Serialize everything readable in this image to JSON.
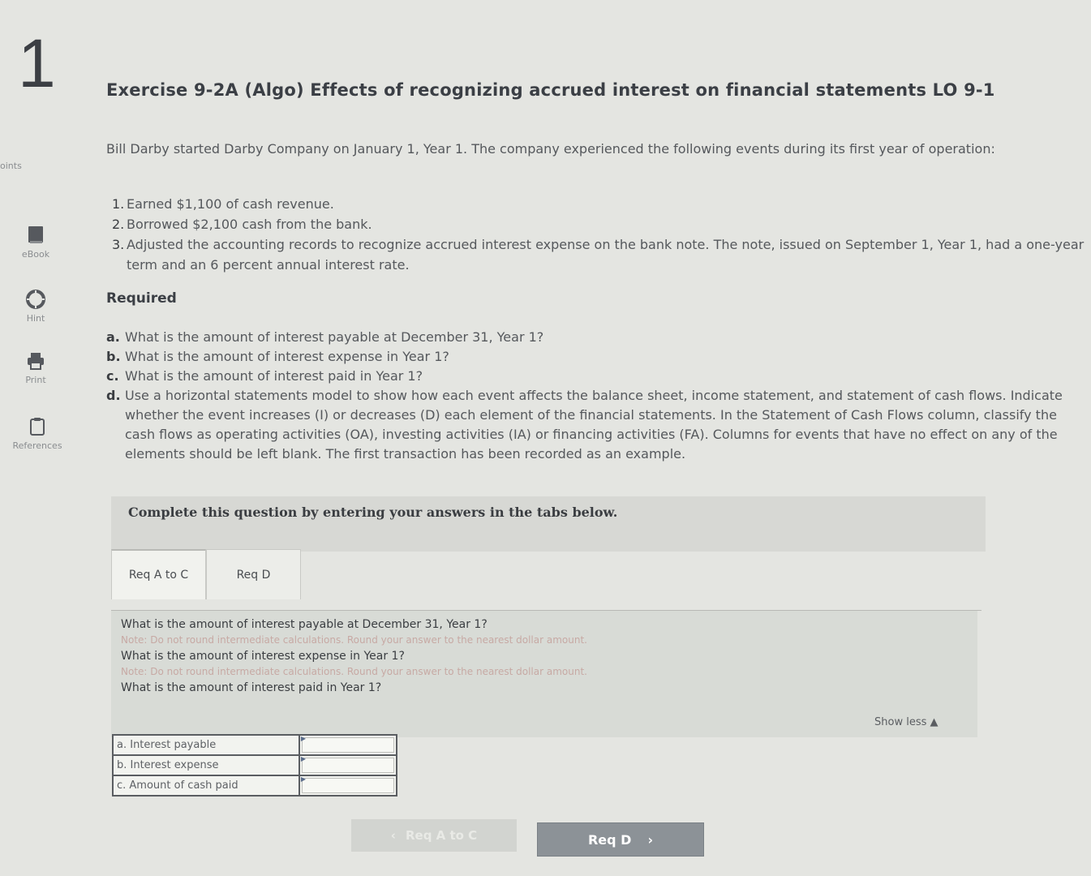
{
  "question_number": "1",
  "sidebar": {
    "points_label": "oints",
    "ebook_label": "eBook",
    "hint_label": "Hint",
    "print_label": "Print",
    "references_label": "References"
  },
  "title": "Exercise 9-2A (Algo) Effects of recognizing accrued interest on financial statements LO 9-1",
  "intro": "Bill Darby started Darby Company on January 1, Year 1. The company experienced the following events during its first year of operation:",
  "events": [
    {
      "num": "1.",
      "text": "Earned $1,100 of cash revenue."
    },
    {
      "num": "2.",
      "text": "Borrowed $2,100 cash from the bank."
    },
    {
      "num": "3.",
      "text": "Adjusted the accounting records to recognize accrued interest expense on the bank note. The note, issued on September 1, Year 1, had a one-year term and an 6 percent annual interest rate."
    }
  ],
  "required_heading": "Required",
  "parts": [
    {
      "letter": "a.",
      "text": "What is the amount of interest payable at December 31, Year 1?"
    },
    {
      "letter": "b.",
      "text": "What is the amount of interest expense in Year 1?"
    },
    {
      "letter": "c.",
      "text": "What is the amount of interest paid in Year 1?"
    },
    {
      "letter": "d.",
      "text": "Use a horizontal statements model to show how each event affects the balance sheet, income statement, and statement of cash flows. Indicate whether the event increases (I) or decreases (D) each element of the financial statements. In the Statement of Cash Flows column, classify the cash flows as operating activities (OA), investing activities (IA) or financing activities (FA). Columns for events that have no effect on any of the elements should be left blank. The first transaction has been recorded as an example."
    }
  ],
  "instructions": "Complete this question by entering your answers in the tabs below.",
  "tabs": [
    {
      "label": "Req A to C"
    },
    {
      "label": "Req D"
    }
  ],
  "panel": {
    "q1": "What is the amount of interest payable at December 31, Year 1?",
    "note1": "Note: Do not round intermediate calculations. Round your answer to the nearest dollar amount.",
    "q2": "What is the amount of interest expense in Year 1?",
    "note2": "Note: Do not round intermediate calculations. Round your answer to the nearest dollar amount.",
    "q3": "What is the amount of interest paid in Year 1?",
    "show_less": "Show less ▲"
  },
  "answer_rows": [
    {
      "label": "a. Interest payable",
      "value": ""
    },
    {
      "label": "b. Interest expense",
      "value": ""
    },
    {
      "label": "c. Amount of cash paid",
      "value": ""
    }
  ],
  "nav": {
    "prev_label": "Req A to C",
    "next_label": "Req D"
  }
}
